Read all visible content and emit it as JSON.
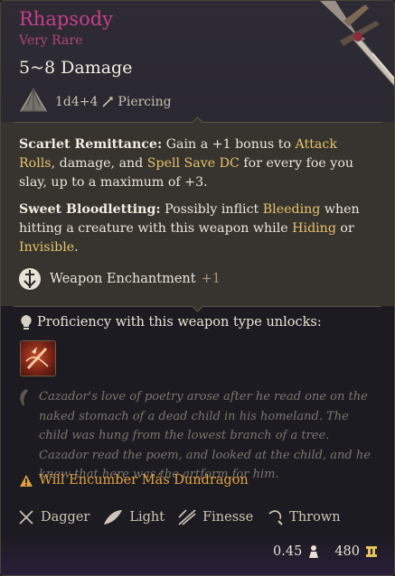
{
  "item": {
    "name": "Rhapsody",
    "rarity": "Very Rare",
    "damage": "5~8 Damage",
    "dice": "1d4+4",
    "damage_type": "Piercing"
  },
  "passives": [
    {
      "name": "Scarlet Remittance:",
      "t1": "Gain a +1 bonus to ",
      "k1": "Attack Rolls",
      "t2": ", damage, and ",
      "k2": "Spell Save DC",
      "t3": " for every foe you slay, up to a maximum of +3."
    },
    {
      "name": "Sweet Bloodletting:",
      "t1": "Possibly inflict ",
      "k1": "Bleeding",
      "t2": " when hitting a creature with this weapon while ",
      "k2": "Hiding",
      "t3": " or ",
      "k3": "Invisible",
      "t4": "."
    }
  ],
  "enchantment": {
    "label": "Weapon Enchantment",
    "bonus": "+1"
  },
  "proficiency": {
    "label": "Proficiency with this weapon type unlocks:"
  },
  "lore": "Cazador's love of poetry arose after he read one on the naked stomach of a dead child in his homeland. The child was hung from the lowest branch of a tree. Cazador read the poem, and looked at the child, and he knew that here was the artform for him.",
  "encumber": "Will Encumber Más Dundragon",
  "properties": [
    {
      "label": "Dagger",
      "icon": "dagger-icon"
    },
    {
      "label": "Light",
      "icon": "feather-icon"
    },
    {
      "label": "Finesse",
      "icon": "finesse-icon"
    },
    {
      "label": "Thrown",
      "icon": "thrown-icon"
    }
  ],
  "footer": {
    "weight": "0.45",
    "value": "480"
  },
  "colors": {
    "rarity": "#c83e8a",
    "keyword": "#e6c26a",
    "warning": "#e2a240"
  }
}
